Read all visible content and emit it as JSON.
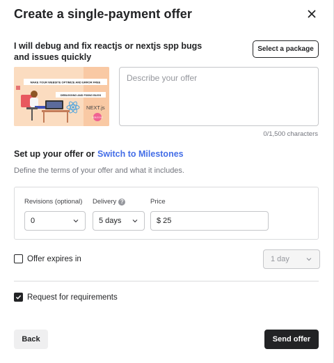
{
  "modal": {
    "title": "Create a single-payment offer",
    "close_icon": "close-icon"
  },
  "gig": {
    "title": "I will debug and fix reactjs or nextjs spp bugs and issues quickly",
    "select_package_label": "Select a package",
    "thumbnail": {
      "banner_text": "MAKE YOUR WEBSITE OPTIMIZE AND ERROR FREE",
      "subtitle": "DEBUGGING AND FIXING BUGS",
      "logo_text": "NEXT.js",
      "badge_text": "DEBUGGING"
    }
  },
  "description": {
    "placeholder": "Describe your offer",
    "char_count": "0/1,500 characters"
  },
  "setup": {
    "prefix": "Set up your offer or",
    "link": "Switch to Milestones",
    "hint": "Define the terms of your offer and what it includes."
  },
  "terms": {
    "revisions": {
      "label": "Revisions (optional)",
      "value": "0"
    },
    "delivery": {
      "label": "Delivery",
      "value": "5 days"
    },
    "price": {
      "label": "Price",
      "value": "$ 25"
    }
  },
  "expires": {
    "label": "Offer expires in",
    "checked": false,
    "value": "1 day"
  },
  "requirements": {
    "label": "Request for requirements",
    "checked": true
  },
  "footer": {
    "back_label": "Back",
    "send_label": "Send offer"
  },
  "colors": {
    "primary_dark": "#222325",
    "link_blue": "#446ee7",
    "border": "#dadbdd"
  }
}
